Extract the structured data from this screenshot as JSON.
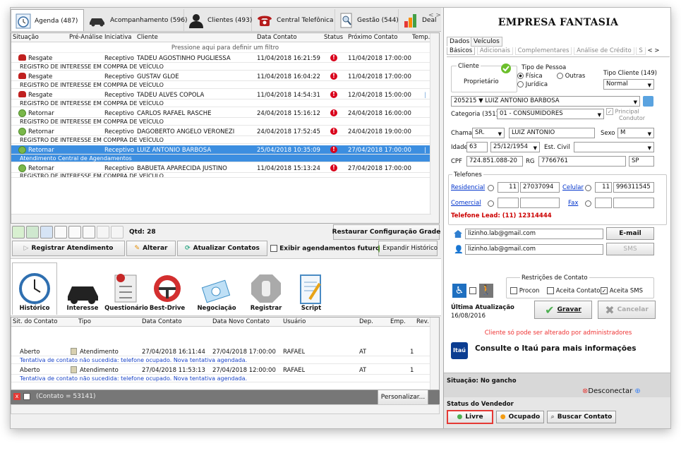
{
  "tabs": [
    {
      "label": "Agenda (487)",
      "icon": "clock-icon"
    },
    {
      "label": "Acompanhamento (596)",
      "icon": "car-icon"
    },
    {
      "label": "Clientes (493)",
      "icon": "person-icon"
    },
    {
      "label": "Central Telefônica",
      "icon": "phone-icon"
    },
    {
      "label": "Gestão (544)",
      "icon": "magnifier-icon"
    },
    {
      "label": "Deal",
      "icon": "bar-chart-icon"
    }
  ],
  "grid": {
    "headers": [
      "Situação",
      "Pré-Análise",
      "Iniciativa",
      "Cliente",
      "Data Contato",
      "Status",
      "Próximo Contato",
      "Temp."
    ],
    "filter_text": "Pressione aqui para definir um filtro",
    "rows": [
      {
        "situacao": "Resgate",
        "icon": "phone",
        "iniciativa": "Receptivo",
        "cliente": "TADEU AGOSTINHO PUGLIESSA",
        "data": "11/04/2018 16:21:59",
        "proximo": "11/04/2018 17:00:00",
        "sub": "REGISTRO DE INTERESSE EM COMPRA DE VEÍCULO",
        "temp": false
      },
      {
        "situacao": "Resgate",
        "icon": "phone",
        "iniciativa": "Receptivo",
        "cliente": "GUSTAV GLOE",
        "data": "11/04/2018 16:04:22",
        "proximo": "11/04/2018 17:00:00",
        "sub": "REGISTRO DE INTERESSE EM COMPRA DE VEÍCULO",
        "temp": false
      },
      {
        "situacao": "Resgate",
        "icon": "phone",
        "iniciativa": "Receptivo",
        "cliente": "TADEU ALVES COPOLA",
        "data": "11/04/2018 14:54:31",
        "proximo": "12/04/2018 15:00:00",
        "sub": "REGISTRO DE INTERESSE EM COMPRA DE VEÍCULO",
        "temp": true
      },
      {
        "situacao": "Retornar",
        "icon": "refresh",
        "iniciativa": "Receptivo",
        "cliente": "CARLOS RAFAEL RASCHE",
        "data": "24/04/2018 15:16:12",
        "proximo": "24/04/2018 16:00:00",
        "sub": "REGISTRO DE INTERESSE EM COMPRA DE VEÍCULO",
        "temp": false
      },
      {
        "situacao": "Retornar",
        "icon": "refresh",
        "iniciativa": "Receptivo",
        "cliente": "DAGOBERTO ANGELO VERONEZI",
        "data": "24/04/2018 17:52:45",
        "proximo": "24/04/2018 19:00:00",
        "sub": "REGISTRO DE INTERESSE EM COMPRA DE VEÍCULO",
        "temp": false
      },
      {
        "situacao": "Retornar",
        "icon": "refresh",
        "iniciativa": "Receptivo",
        "cliente": "LUIZ ANTONIO BARBOSA",
        "data": "25/04/2018 10:35:09",
        "proximo": "27/04/2018 17:00:00",
        "sub": "Atendimento Central de Agendamentos",
        "temp": true,
        "selected": true
      },
      {
        "situacao": "Retornar",
        "icon": "refresh",
        "iniciativa": "Receptivo",
        "cliente": "BABUETA APARECIDA JUSTINO",
        "data": "11/04/2018 15:13:24",
        "proximo": "27/04/2018 17:00:00",
        "sub": "REGISTRO DE INTERESSE EM COMPRA DE VEÍCULO",
        "temp": false
      }
    ]
  },
  "toolbar": {
    "qtd": "Qtd: 28",
    "restore": "Restaurar Configuração Grade"
  },
  "actions": {
    "register": "Registrar Atendimento",
    "alter": "Alterar",
    "update": "Atualizar Contatos",
    "future": "Exibir agendamentos futuros",
    "expand": "Expandir Histórico"
  },
  "modules": [
    "Histórico",
    "Interesse",
    "Questionário",
    "Best-Drive",
    "Negociação",
    "Registrar",
    "Script"
  ],
  "history": {
    "headers": [
      "Sit. do Contato",
      "Tipo",
      "Data Contato",
      "Data Novo Contato",
      "Usuário",
      "Dep.",
      "Emp.",
      "Rev."
    ],
    "rows": [
      {
        "sit": "Aberto",
        "tipo": "Atendimento",
        "data": "27/04/2018 16:11:44",
        "novo": "27/04/2018 17:00:00",
        "usuario": "RAFAEL",
        "dep": "AT",
        "emp": "1",
        "note": "Tentativa de contato não sucedida: telefone ocupado. Nova tentativa agendada."
      },
      {
        "sit": "Aberto",
        "tipo": "Atendimento",
        "data": "27/04/2018 11:53:13",
        "novo": "27/04/2018 12:00:00",
        "usuario": "RAFAEL",
        "dep": "AT",
        "emp": "1",
        "note": "Tentativa de contato não sucedida: telefone ocupado. Nova tentativa agendada."
      }
    ],
    "footer": "(Contato = 53141)",
    "customize": "Personalizar..."
  },
  "right": {
    "company": "EMPRESA FANTASIA",
    "main_tabs": [
      "Dados",
      "Veículos"
    ],
    "sub_tabs": [
      "Básicos",
      "Adicionais",
      "Complementares",
      "Análise de Crédito",
      "S"
    ],
    "cliente_label": "Cliente",
    "proprietario": "Proprietário",
    "tipo_pessoa": "Tipo de Pessoa",
    "fisica": "Física",
    "outras": "Outras",
    "juridica": "Jurídica",
    "tipo_cliente": "Tipo Cliente (149)",
    "tipo_cliente_val": "Normal",
    "cliente_id": "205215",
    "cliente_nome": "LUIZ ANTONIO BARBOSA",
    "categoria_label": "Categoria (351)",
    "categoria_val": "01 - CONSUMIDORES",
    "principal": "Principal",
    "condutor": "Condutor",
    "chamar_label": "Chamar",
    "chamar_val": "SR.",
    "chamar_nome": "LUIZ ANTONIO",
    "sexo_label": "Sexo",
    "sexo_val": "M",
    "idade_label": "Idade",
    "idade_val": "63",
    "nasc_val": "25/12/1954",
    "estcivil_label": "Est. Civil",
    "cpf_label": "CPF",
    "cpf_val": "724.851.088-20",
    "rg_label": "RG",
    "rg_val": "7766761",
    "uf_val": "SP",
    "telefones": "Telefones",
    "residencial": "Residencial",
    "res_ddd": "11",
    "res_num": "27037094",
    "celular": "Celular",
    "cel_ddd": "11",
    "cel_num": "996311545",
    "comercial": "Comercial",
    "fax": "Fax",
    "lead": "Telefone Lead: (11) 12314444",
    "email1": "lizinho.lab@gmail.com",
    "email_btn": "E-mail",
    "email2": "lizinho.lab@gmail.com",
    "sms_btn": "SMS",
    "restricoes": "Restrições de Contato",
    "procon": "Procon",
    "aceita_contato": "Aceita Contato",
    "aceita_sms": "Aceita SMS",
    "ultima_label": "Última Atualização",
    "ultima_val": "16/08/2016",
    "gravar": "Gravar",
    "cancelar": "Cancelar",
    "admin_note": "Cliente só pode ser alterado por administradores",
    "itau_logo": "Itaú",
    "itau_msg": "Consulte o Itaú para mais informações",
    "situacao": "Situação: No gancho",
    "desconectar": "Desconectar",
    "status_vendedor": "Status do Vendedor",
    "livre": "Livre",
    "ocupado": "Ocupado",
    "buscar": "Buscar Contato"
  },
  "colors": {
    "accent": "#3c8ee0",
    "alert": "#d9001b",
    "lead": "#cc0000",
    "green": "#4caf50",
    "orange": "#f39c12"
  }
}
